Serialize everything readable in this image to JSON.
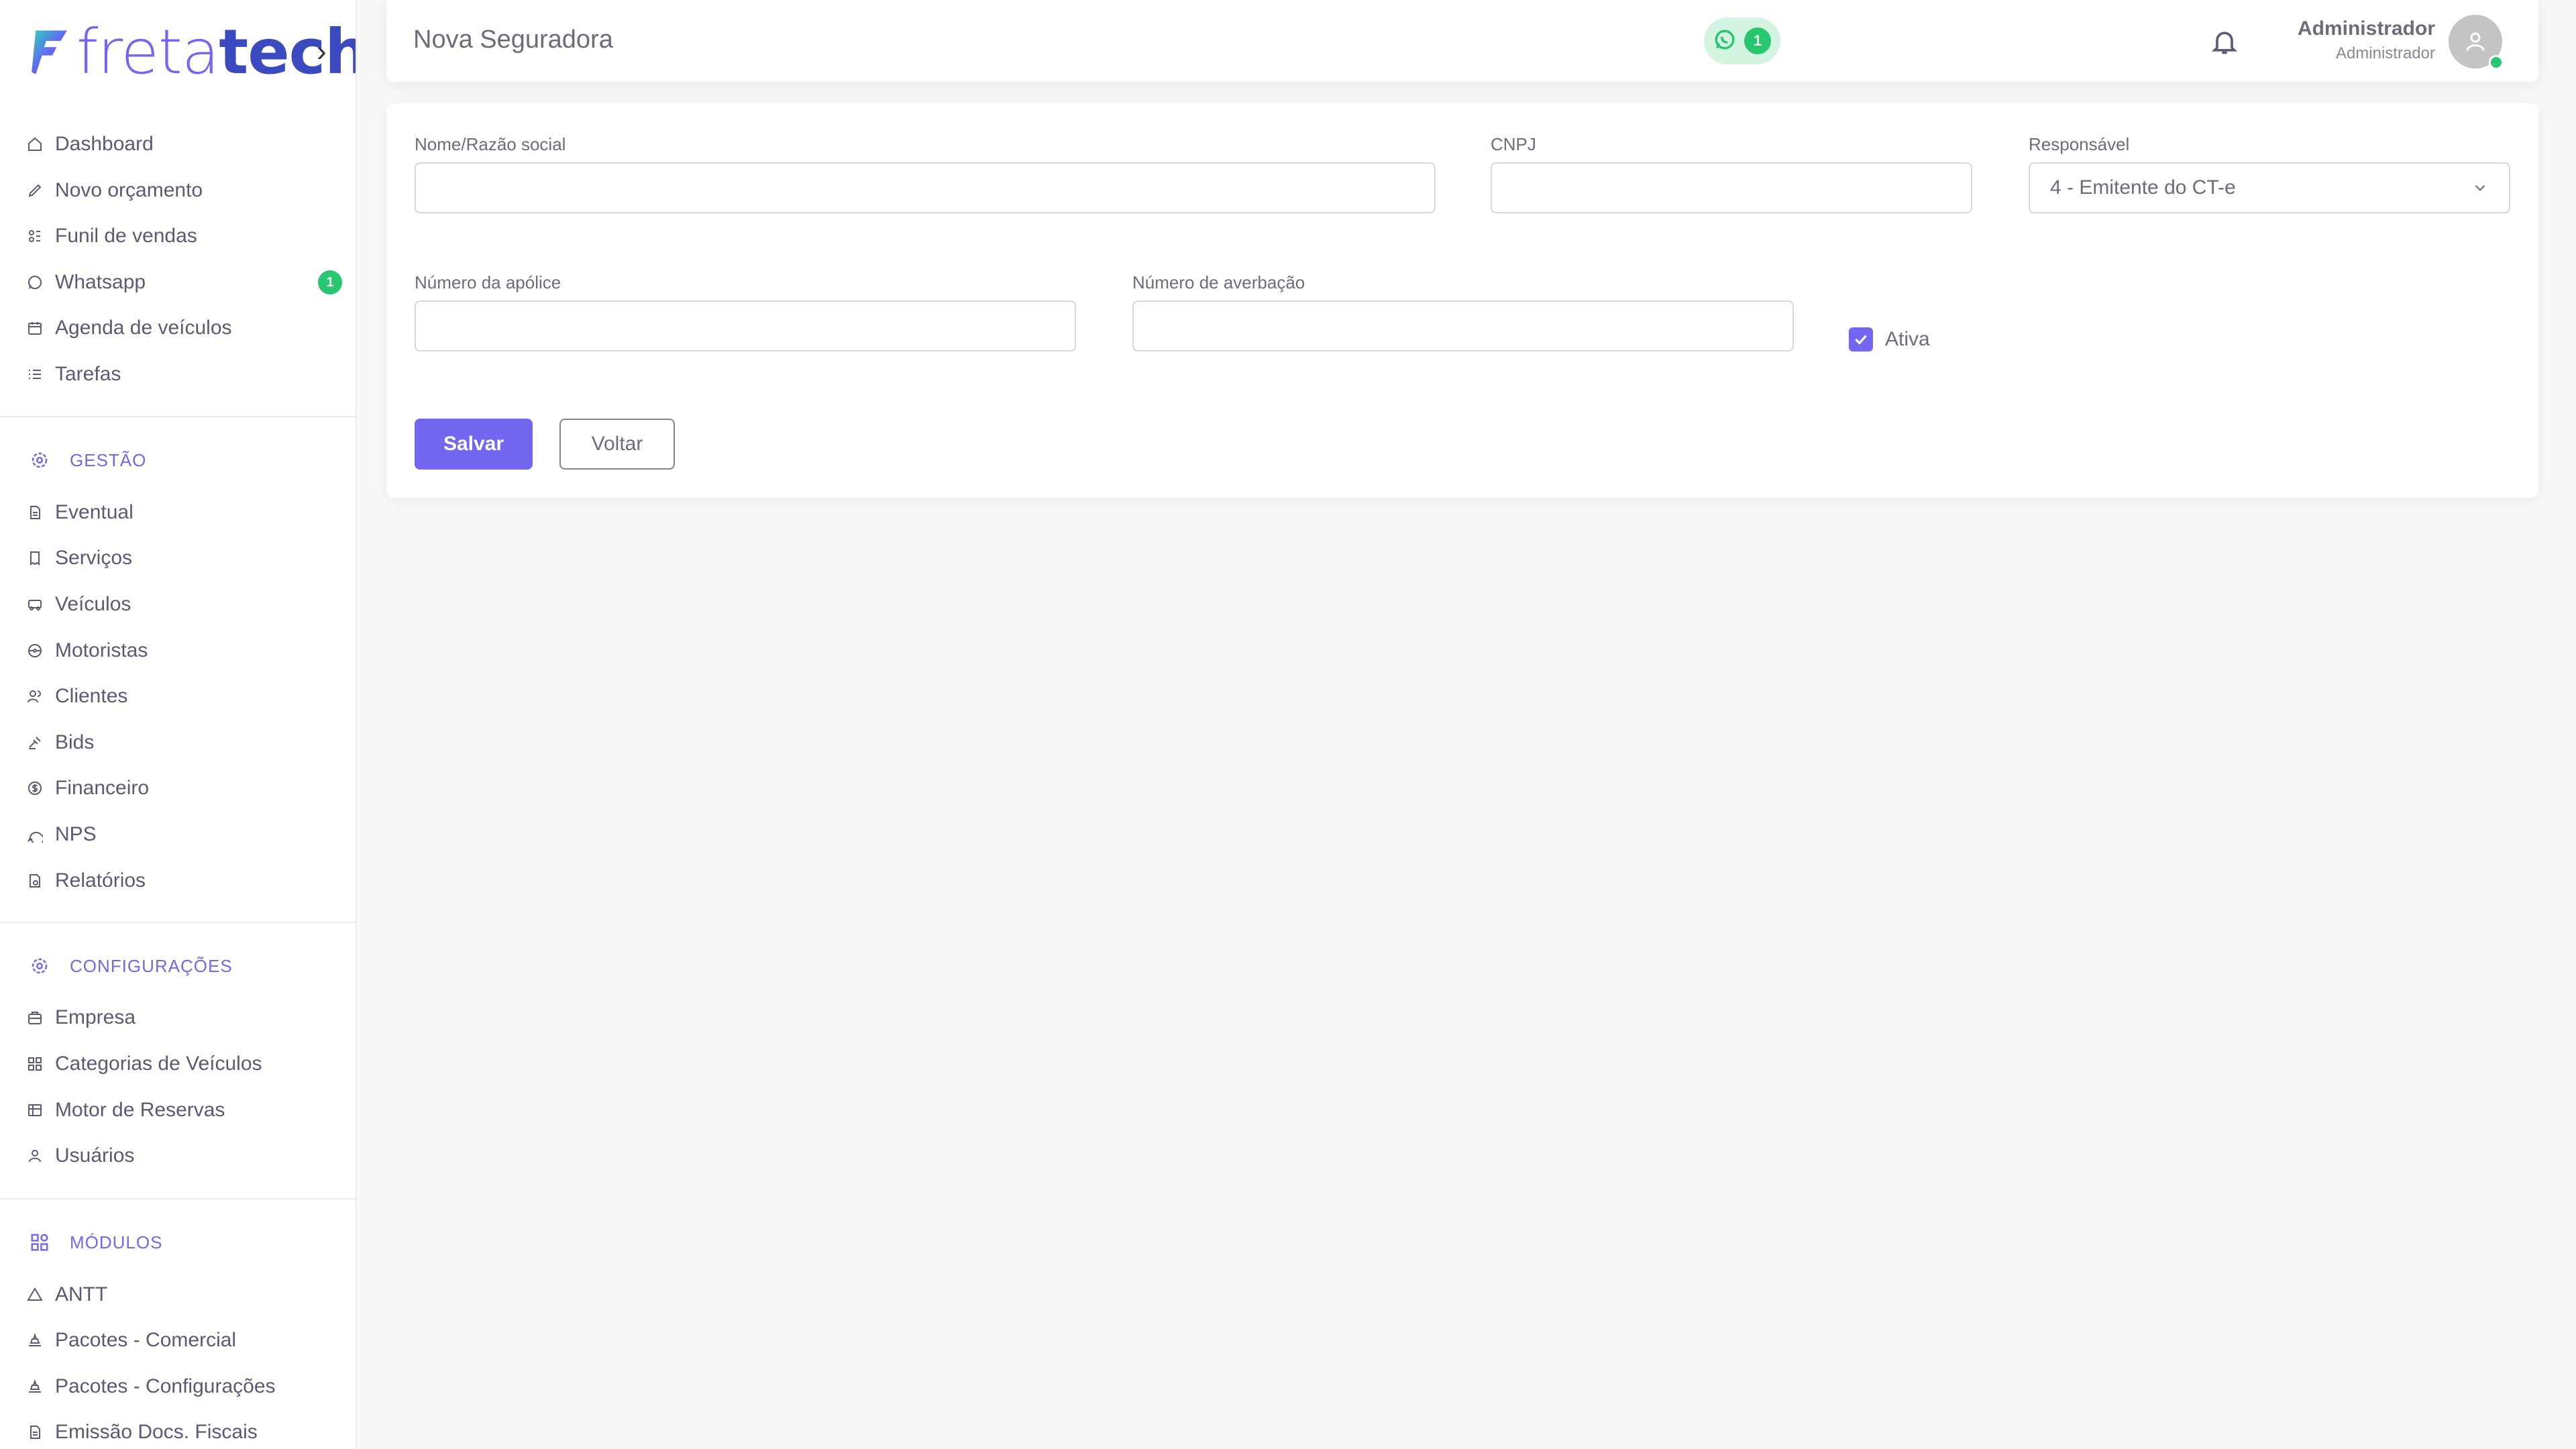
{
  "brand": {
    "part1": "freta",
    "part2": "tech"
  },
  "nav_main": [
    {
      "label": "Dashboard",
      "icon": "home-icon"
    },
    {
      "label": "Novo orçamento",
      "icon": "edit-icon"
    },
    {
      "label": "Funil de vendas",
      "icon": "funnel-icon"
    },
    {
      "label": "Whatsapp",
      "icon": "whatsapp-icon",
      "badge": "1"
    },
    {
      "label": "Agenda de veículos",
      "icon": "calendar-icon"
    },
    {
      "label": "Tarefas",
      "icon": "list-icon"
    }
  ],
  "section_gestao": {
    "title": "GESTÃO",
    "icon": "gear-icon"
  },
  "nav_gestao": [
    {
      "label": "Eventual",
      "icon": "document-icon"
    },
    {
      "label": "Serviços",
      "icon": "receipt-icon"
    },
    {
      "label": "Veículos",
      "icon": "bus-icon"
    },
    {
      "label": "Motoristas",
      "icon": "steering-wheel-icon"
    },
    {
      "label": "Clientes",
      "icon": "users-icon"
    },
    {
      "label": "Bids",
      "icon": "gavel-icon"
    },
    {
      "label": "Financeiro",
      "icon": "dollar-icon"
    },
    {
      "label": "NPS",
      "icon": "chat-icon"
    },
    {
      "label": "Relatórios",
      "icon": "report-icon"
    }
  ],
  "section_config": {
    "title": "CONFIGURAÇÕES",
    "icon": "gear-icon"
  },
  "nav_config": [
    {
      "label": "Empresa",
      "icon": "building-icon"
    },
    {
      "label": "Categorias de Veículos",
      "icon": "grid-icon"
    },
    {
      "label": "Motor de Reservas",
      "icon": "table-icon"
    },
    {
      "label": "Usuários",
      "icon": "user-icon"
    }
  ],
  "section_modulos": {
    "title": "MÓDULOS",
    "icon": "apps-icon"
  },
  "nav_modulos": [
    {
      "label": "ANTT",
      "icon": "triangle-icon"
    },
    {
      "label": "Pacotes - Comercial",
      "icon": "package-icon"
    },
    {
      "label": "Pacotes - Configurações",
      "icon": "package-icon"
    },
    {
      "label": "Emissão Docs. Fiscais",
      "icon": "document-icon"
    }
  ],
  "header": {
    "title": "Nova Seguradora",
    "whatsapp_count": "1",
    "user_name": "Administrador",
    "user_role": "Administrador"
  },
  "form": {
    "name_label": "Nome/Razão social",
    "name_value": "",
    "cnpj_label": "CNPJ",
    "cnpj_value": "",
    "responsavel_label": "Responsável",
    "responsavel_value": "4 - Emitente do CT-e",
    "apolice_label": "Número da apólice",
    "apolice_value": "",
    "averbacao_label": "Número de averbação",
    "averbacao_value": "",
    "ativa_label": "Ativa",
    "ativa_checked": true,
    "save_label": "Salvar",
    "back_label": "Voltar"
  },
  "colors": {
    "primary": "#7367f0",
    "success": "#28c76f",
    "text": "#6e6b7b"
  }
}
